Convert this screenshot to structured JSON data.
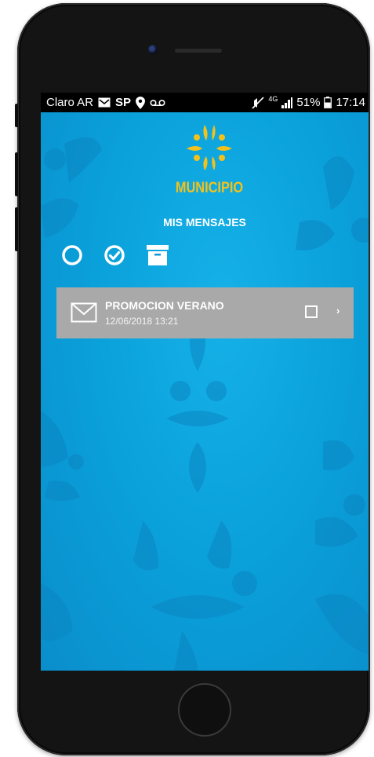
{
  "statusbar": {
    "carrier": "Claro AR",
    "sp_label": "SP",
    "network": "4G",
    "battery": "51%",
    "time": "17:14"
  },
  "app": {
    "logo_text": "MUNICIPIO",
    "page_title": "MIS MENSAJES",
    "toolbar": {
      "unread_icon": "circle-outline-icon",
      "read_icon": "check-circle-icon",
      "archive_icon": "archive-box-icon"
    },
    "messages": [
      {
        "title": "PROMOCION VERANO",
        "date": "12/06/2018 13:21",
        "icon": "envelope-icon",
        "checked": false
      }
    ]
  },
  "colors": {
    "screen_blue": "#0c9ad3",
    "logo_yellow": "#f2c21b",
    "message_row_gray": "#a9a9a9",
    "status_bar": "#000000"
  }
}
